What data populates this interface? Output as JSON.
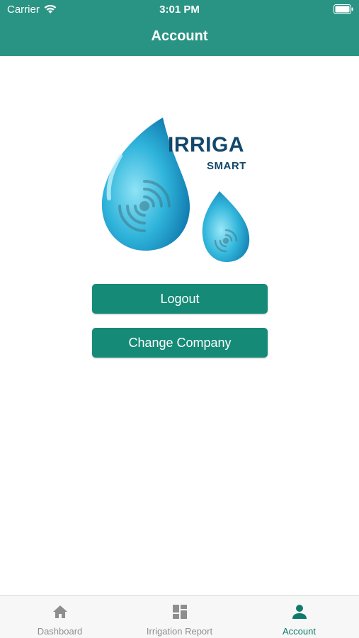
{
  "status_bar": {
    "carrier": "Carrier",
    "time": "3:01 PM"
  },
  "header": {
    "title": "Account"
  },
  "logo": {
    "brand": "IRRIGA",
    "tagline": "SMART"
  },
  "buttons": {
    "logout": "Logout",
    "change_company": "Change Company"
  },
  "tabs": [
    {
      "label": "Dashboard",
      "icon": "home-icon",
      "active": false
    },
    {
      "label": "Irrigation Report",
      "icon": "dashboard-grid-icon",
      "active": false
    },
    {
      "label": "Account",
      "icon": "person-icon",
      "active": true
    }
  ],
  "colors": {
    "primary": "#2a9484",
    "button": "#158a77",
    "active_tab": "#0f7a6b",
    "inactive_tab": "#8e8e8e",
    "logo_text": "#13476b"
  }
}
